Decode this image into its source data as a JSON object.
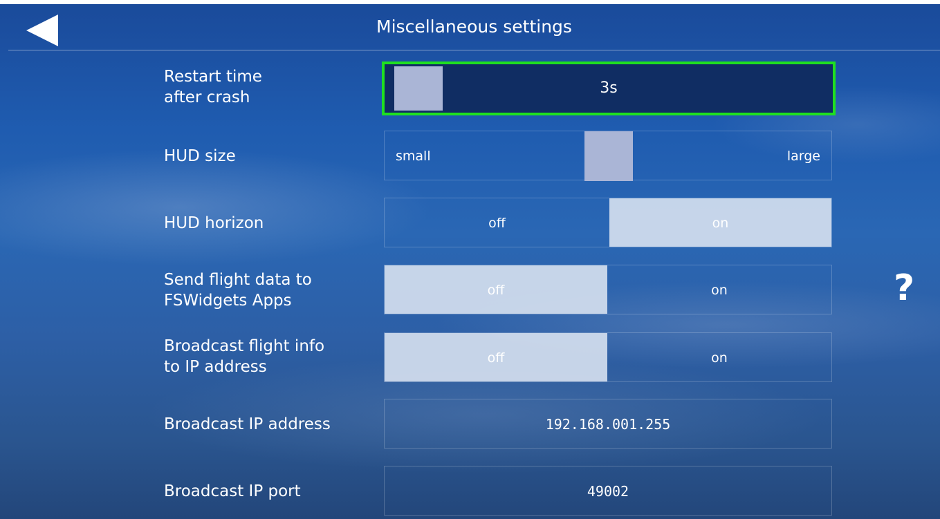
{
  "header": {
    "title": "Miscellaneous settings"
  },
  "settings": {
    "restart_time": {
      "label_line1": "Restart time",
      "label_line2": "after crash",
      "value": "3s"
    },
    "hud_size": {
      "label": "HUD size",
      "min_label": "small",
      "max_label": "large",
      "level": 0.5
    },
    "hud_horizon": {
      "label": "HUD horizon",
      "off": "off",
      "on": "on",
      "selected": "on"
    },
    "send_flight_data": {
      "label_line1": "Send flight data to",
      "label_line2": "FSWidgets Apps",
      "off": "off",
      "on": "on",
      "selected": "off"
    },
    "broadcast_flight_info": {
      "label_line1": "Broadcast flight info",
      "label_line2": "to IP address",
      "off": "off",
      "on": "on",
      "selected": "off"
    },
    "broadcast_ip": {
      "label": "Broadcast IP address",
      "value": "192.168.001.255"
    },
    "broadcast_port": {
      "label": "Broadcast IP port",
      "value": "49002"
    }
  },
  "help": {
    "symbol": "?"
  },
  "colors": {
    "focus_border": "#1fe01f",
    "active_segment": "#d7e1f0",
    "handle": "#aab5d6"
  },
  "icons": {
    "back": "back-arrow-icon",
    "help": "help-icon"
  }
}
